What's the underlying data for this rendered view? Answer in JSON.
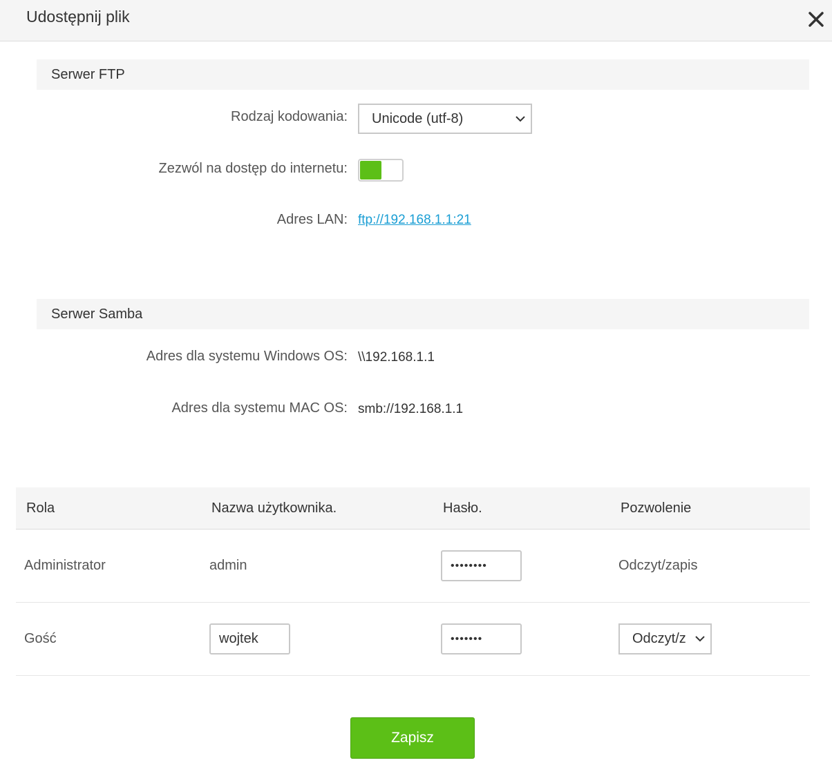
{
  "dialog": {
    "title": "Udostępnij plik",
    "close_icon": "close-icon"
  },
  "ftp": {
    "section_title": "Serwer FTP",
    "encoding_label": "Rodzaj kodowania:",
    "encoding_value": "Unicode (utf-8)",
    "internet_access_label": "Zezwól na dostęp do internetu:",
    "internet_access_enabled": true,
    "lan_label": "Adres LAN:",
    "lan_value": "ftp://192.168.1.1:21"
  },
  "samba": {
    "section_title": "Serwer Samba",
    "windows_label": "Adres dla systemu Windows OS:",
    "windows_value": "\\\\192.168.1.1",
    "mac_label": "Adres dla systemu MAC OS:",
    "mac_value": "smb://192.168.1.1"
  },
  "users_table": {
    "headers": [
      "Rola",
      "Nazwa użytkownika.",
      "Hasło.",
      "Pozwolenie"
    ],
    "rows": [
      {
        "role": "Administrator",
        "username": "admin",
        "password_mask": "••••••••",
        "permission": "Odczyt/zapis"
      },
      {
        "role": "Gość",
        "username": "wojtek",
        "password_mask": "•••••••",
        "permission": "Odczyt/z"
      }
    ]
  },
  "actions": {
    "save_label": "Zapisz"
  },
  "colors": {
    "accent_green": "#5cbf17",
    "link_blue": "#1a9ed4"
  }
}
